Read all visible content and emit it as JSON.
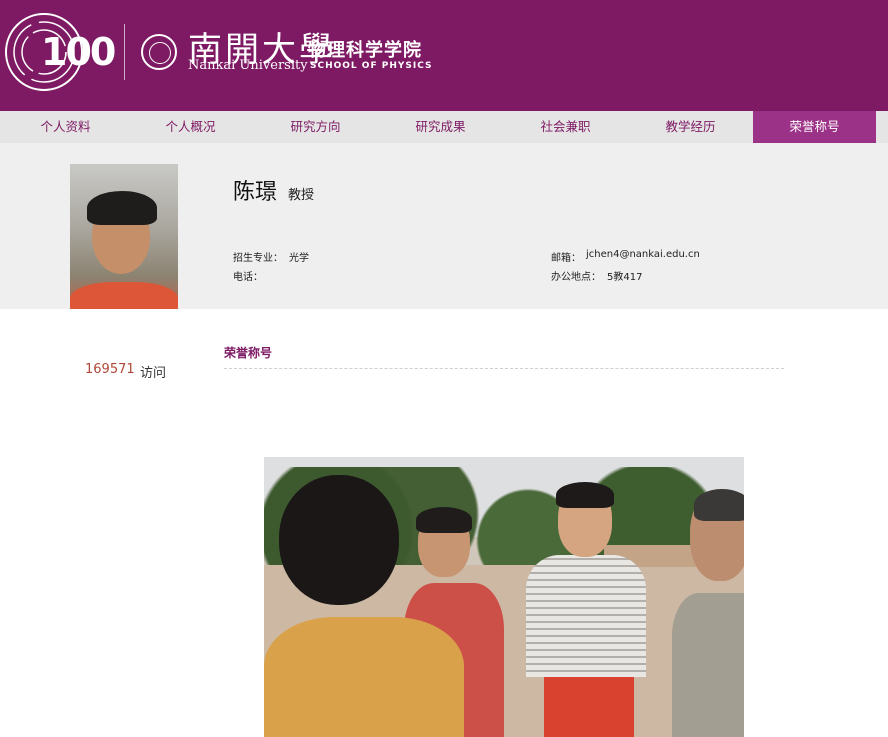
{
  "header": {
    "centennial_logo": "100",
    "university_cn": "南開大學",
    "university_en": "Nankai University",
    "school_cn": "物理科学学院",
    "school_en": "SCHOOL OF PHYSICS"
  },
  "nav": [
    {
      "label": "个人资料"
    },
    {
      "label": "个人概况"
    },
    {
      "label": "研究方向"
    },
    {
      "label": "研究成果"
    },
    {
      "label": "社会兼职"
    },
    {
      "label": "教学经历"
    },
    {
      "label": "荣誉称号",
      "active": true
    }
  ],
  "profile": {
    "name": "陈璟",
    "title": "教授",
    "major_label": "招生专业：",
    "major_value": "光学",
    "phone_label": "电话：",
    "phone_value": "",
    "email_label": "邮箱：",
    "email_value": "jchen4@nankai.edu.cn",
    "office_label": "办公地点：",
    "office_value": "5教417"
  },
  "visits": {
    "count": "169571",
    "label": "访问"
  },
  "section": {
    "title": "荣誉称号"
  },
  "colors": {
    "brand": "#7e1a64",
    "nav_active": "#9c3287",
    "visit_count": "#b04838"
  }
}
